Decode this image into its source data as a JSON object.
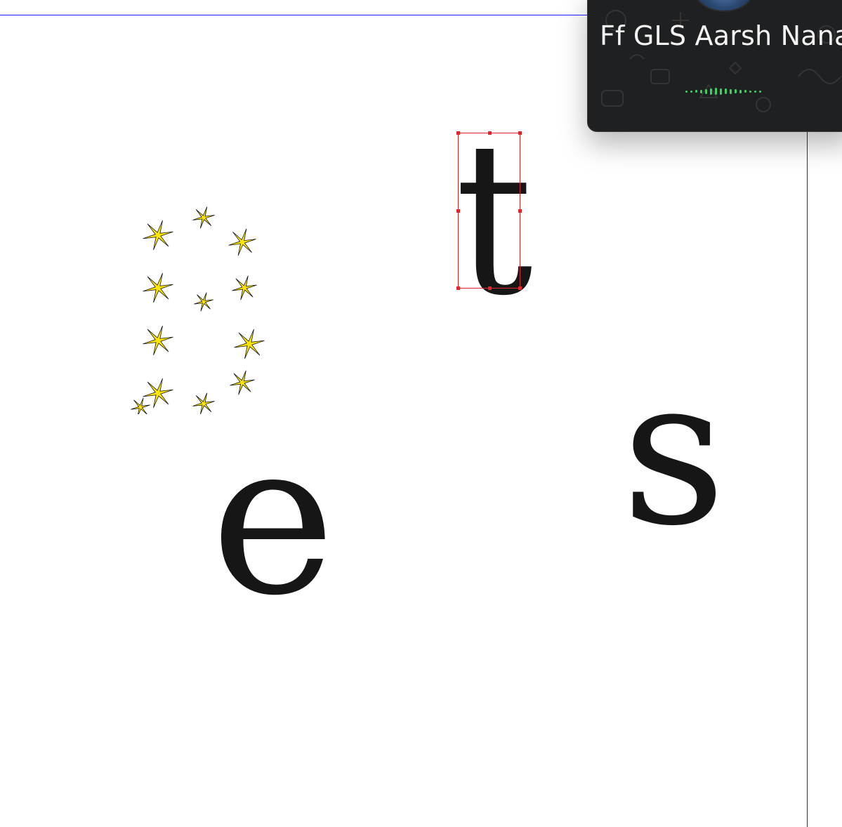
{
  "canvas": {
    "glyphs": {
      "t": "t",
      "e": "e",
      "s": "s"
    },
    "decorated_letter": {
      "letter": "B",
      "fill_color": "#ffe600",
      "pattern_icon": "star-icon"
    },
    "guide_color": "#1a1aff",
    "selection_color": "#e0262b"
  },
  "call_popup": {
    "caller_name": "Ff GLS Aarsh Nanav",
    "avatar_icon": "avatar",
    "wave_color": "#3fcf62",
    "wave_icon": "voice-activity-icon"
  }
}
